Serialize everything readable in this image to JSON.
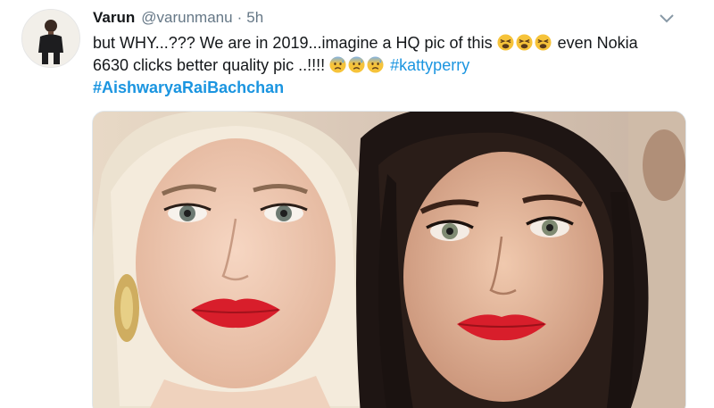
{
  "tweet": {
    "display_name": "Varun",
    "handle": "@varunmanu",
    "separator": "·",
    "time": "5h",
    "line1_text": "but WHY...??? We are in 2019...imagine a HQ pic of this",
    "line1_tail": "even Nokia",
    "line2_text": "6630 clicks better quality pic ..!!!!",
    "hashtag_1": "#kattyperry",
    "hashtag_2": "#AishwaryaRaiBachchan",
    "emojis": {
      "group1": "tired-face-emoji",
      "group2": "anxious-face-with-sweat-emoji"
    },
    "icons": {
      "more": "chevron-down-icon",
      "avatar": "avatar"
    },
    "colors": {
      "link": "#1b95e0",
      "text": "#14171a",
      "muted": "#657786",
      "lips": "#d81e2b"
    }
  }
}
